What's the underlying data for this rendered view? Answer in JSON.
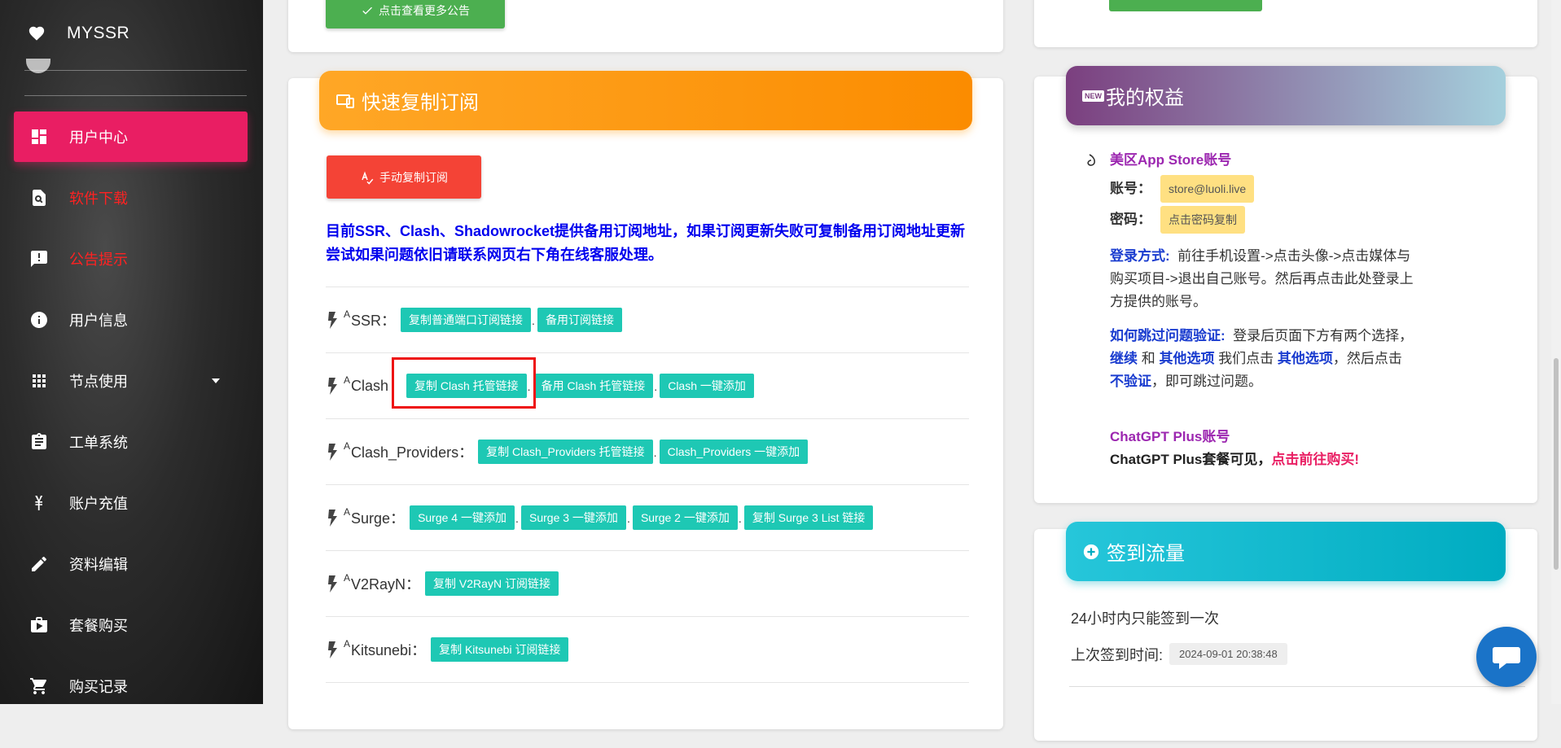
{
  "brand": {
    "name": "MYSSR"
  },
  "sidebar": {
    "items": [
      {
        "label": "用户中心",
        "icon": "dashboard-icon",
        "active": true
      },
      {
        "label": "软件下载",
        "icon": "download-search-icon",
        "red": true
      },
      {
        "label": "公告提示",
        "icon": "announcement-icon",
        "red": true
      },
      {
        "label": "用户信息",
        "icon": "info-icon"
      },
      {
        "label": "节点使用",
        "icon": "apps-grid-icon",
        "has_caret": true
      },
      {
        "label": "工单系统",
        "icon": "clipboard-icon"
      },
      {
        "label": "账户充值",
        "icon": "yen-icon"
      },
      {
        "label": "资料编辑",
        "icon": "pencil-icon"
      },
      {
        "label": "套餐购买",
        "icon": "shopping-bag-icon"
      },
      {
        "label": "购买记录",
        "icon": "cart-icon"
      }
    ]
  },
  "announcements": {
    "more_button": "点击查看更多公告"
  },
  "quick_copy": {
    "title": "快速复制订阅",
    "manual_button": "手动复制订阅",
    "notice": "目前SSR、Clash、Shadowrocket提供备用订阅地址，如果订阅更新失败可复制备用订阅地址更新尝试如果问题依旧请联系网页右下角在线客服处理。",
    "rows": [
      {
        "sup": "A",
        "label": "SSR：",
        "buttons": [
          "复制普通端口订阅链接",
          "备用订阅链接"
        ]
      },
      {
        "sup": "A",
        "label": "Clash",
        "buttons": [
          "复制 Clash 托管链接",
          "备用 Clash 托管链接",
          "Clash 一键添加"
        ]
      },
      {
        "sup": "A",
        "label": "Clash_Providers：",
        "buttons": [
          "复制 Clash_Providers 托管链接",
          "Clash_Providers 一键添加"
        ]
      },
      {
        "sup": "A",
        "label": "Surge：",
        "buttons": [
          "Surge 4 一键添加",
          "Surge 3 一键添加",
          "Surge 2 一键添加",
          "复制 Surge 3 List 链接"
        ]
      },
      {
        "sup": "A",
        "label": "V2RayN：",
        "buttons": [
          "复制 V2RayN 订阅链接"
        ]
      },
      {
        "sup": "A",
        "label": "Kitsunebi：",
        "buttons": [
          "复制 Kitsunebi 订阅链接"
        ]
      }
    ]
  },
  "benefits": {
    "badge": "NEW",
    "title": "我的权益",
    "appstore_title": "美区App Store账号",
    "account_label": "账号：",
    "account_value": "store@luoli.live",
    "password_label": "密码：",
    "password_value": "点击密码复制",
    "login_label": "登录方式:",
    "login_text": "前往手机设置->点击头像->点击媒体与购买项目->退出自己账号。然后再点击此处登录上方提供的账号。",
    "skip_label": "如何跳过问题验证:",
    "skip_text1": "登录后页面下方有两个选择，",
    "skip_continue": "继续",
    "skip_and": " 和 ",
    "skip_other": "其他选项",
    "skip_text2": " 我们点击 ",
    "skip_other2": "其他选项",
    "skip_text3": "，然后点击 ",
    "skip_noverify": "不验证",
    "skip_text4": "，即可跳过问题。",
    "chatgpt_title": "ChatGPT Plus账号",
    "chatgpt_text": "ChatGPT Plus套餐可见，",
    "chatgpt_link": "点击前往购买!"
  },
  "signin": {
    "title": "签到流量",
    "once_text": "24小时内只能签到一次",
    "last_label": "上次签到时间:",
    "last_time": "2024-09-01 20:38:48"
  },
  "colors": {
    "accent_pink": "#e91e63",
    "teal_button": "#1ec8b4",
    "orange_header": "#fb8c00",
    "cyan_header": "#00acc1",
    "notice_blue": "#0000ee"
  }
}
